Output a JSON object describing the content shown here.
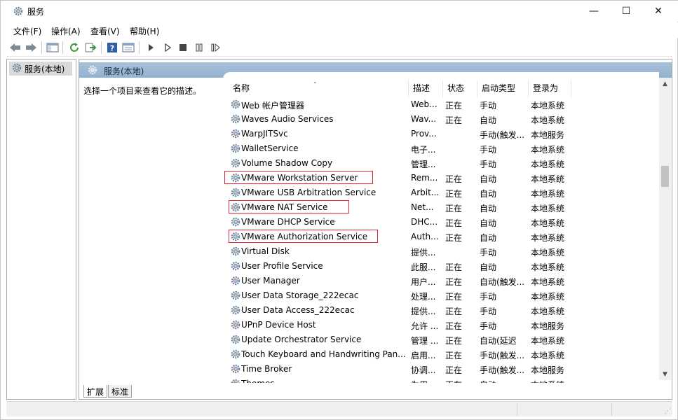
{
  "window": {
    "title": "服务",
    "controls": {
      "minimize": "—",
      "maximize": "☐",
      "close": "✕"
    }
  },
  "menu": [
    "文件(F)",
    "操作(A)",
    "查看(V)",
    "帮助(H)"
  ],
  "toolbar": {
    "icons": [
      "back-arrow-icon",
      "forward-arrow-icon",
      "show-hide-console-tree-icon",
      "refresh-icon",
      "export-list-icon",
      "help-icon",
      "properties-icon",
      "start-service-icon",
      "start-service-alt-icon",
      "stop-service-icon",
      "pause-service-icon",
      "resume-service-icon"
    ]
  },
  "nav": {
    "item_label": "服务(本地)"
  },
  "main": {
    "header_label": "服务(本地)",
    "description_prompt": "选择一个项目来查看它的描述。"
  },
  "columns": {
    "name": "名称",
    "description": "描述",
    "status": "状态",
    "startup": "启动类型",
    "logon": "登录为"
  },
  "services": [
    {
      "name": "Web 帐户管理器",
      "description": "Web...",
      "status": "正在",
      "startup": "手动",
      "logon": "本地系统"
    },
    {
      "name": "Waves Audio Services",
      "description": "Wav...",
      "status": "正在",
      "startup": "自动",
      "logon": "本地系统"
    },
    {
      "name": "WarpJITSvc",
      "description": "Prov...",
      "status": "",
      "startup": "手动(触发...",
      "logon": "本地服务"
    },
    {
      "name": "WalletService",
      "description": "电子...",
      "status": "",
      "startup": "手动",
      "logon": "本地系统"
    },
    {
      "name": "Volume Shadow Copy",
      "description": "管理...",
      "status": "",
      "startup": "手动",
      "logon": "本地系统"
    },
    {
      "name": "VMware Workstation Server",
      "description": "Rem...",
      "status": "正在",
      "startup": "自动",
      "logon": "本地系统",
      "highlighted": true
    },
    {
      "name": "VMware USB Arbitration Service",
      "description": "Arbit...",
      "status": "正在",
      "startup": "自动",
      "logon": "本地系统"
    },
    {
      "name": "VMware NAT Service",
      "description": "Net...",
      "status": "正在",
      "startup": "自动",
      "logon": "本地系统",
      "highlighted": true
    },
    {
      "name": "VMware DHCP Service",
      "description": "DHC...",
      "status": "正在",
      "startup": "自动",
      "logon": "本地系统"
    },
    {
      "name": "VMware Authorization Service",
      "description": "Auth...",
      "status": "正在",
      "startup": "自动",
      "logon": "本地系统",
      "highlighted": true
    },
    {
      "name": "Virtual Disk",
      "description": "提供...",
      "status": "",
      "startup": "手动",
      "logon": "本地系统"
    },
    {
      "name": "User Profile Service",
      "description": "此服...",
      "status": "正在",
      "startup": "自动",
      "logon": "本地系统"
    },
    {
      "name": "User Manager",
      "description": "用户...",
      "status": "正在",
      "startup": "自动(触发...",
      "logon": "本地系统"
    },
    {
      "name": "User Data Storage_222ecac",
      "description": "处理...",
      "status": "正在",
      "startup": "手动",
      "logon": "本地系统"
    },
    {
      "name": "User Data Access_222ecac",
      "description": "提供...",
      "status": "正在",
      "startup": "手动",
      "logon": "本地系统"
    },
    {
      "name": "UPnP Device Host",
      "description": "允许 ...",
      "status": "正在",
      "startup": "手动",
      "logon": "本地服务"
    },
    {
      "name": "Update Orchestrator Service",
      "description": "管理 ...",
      "status": "正在",
      "startup": "自动(延迟",
      "logon": "本地系统"
    },
    {
      "name": "Touch Keyboard and Handwriting Pan...",
      "description": "启用...",
      "status": "正在",
      "startup": "手动(触发...",
      "logon": "本地系统"
    },
    {
      "name": "Time Broker",
      "description": "协调...",
      "status": "正在",
      "startup": "手动(触发...",
      "logon": "本地服务"
    },
    {
      "name": "Themes",
      "description": "为用...",
      "status": "正在",
      "startup": "自动",
      "logon": "本地系统"
    }
  ],
  "tabs": {
    "extended": "扩展",
    "standard": "标准"
  },
  "colors": {
    "highlight_box": "#e0272e",
    "header_band": "#a7c1d9"
  }
}
